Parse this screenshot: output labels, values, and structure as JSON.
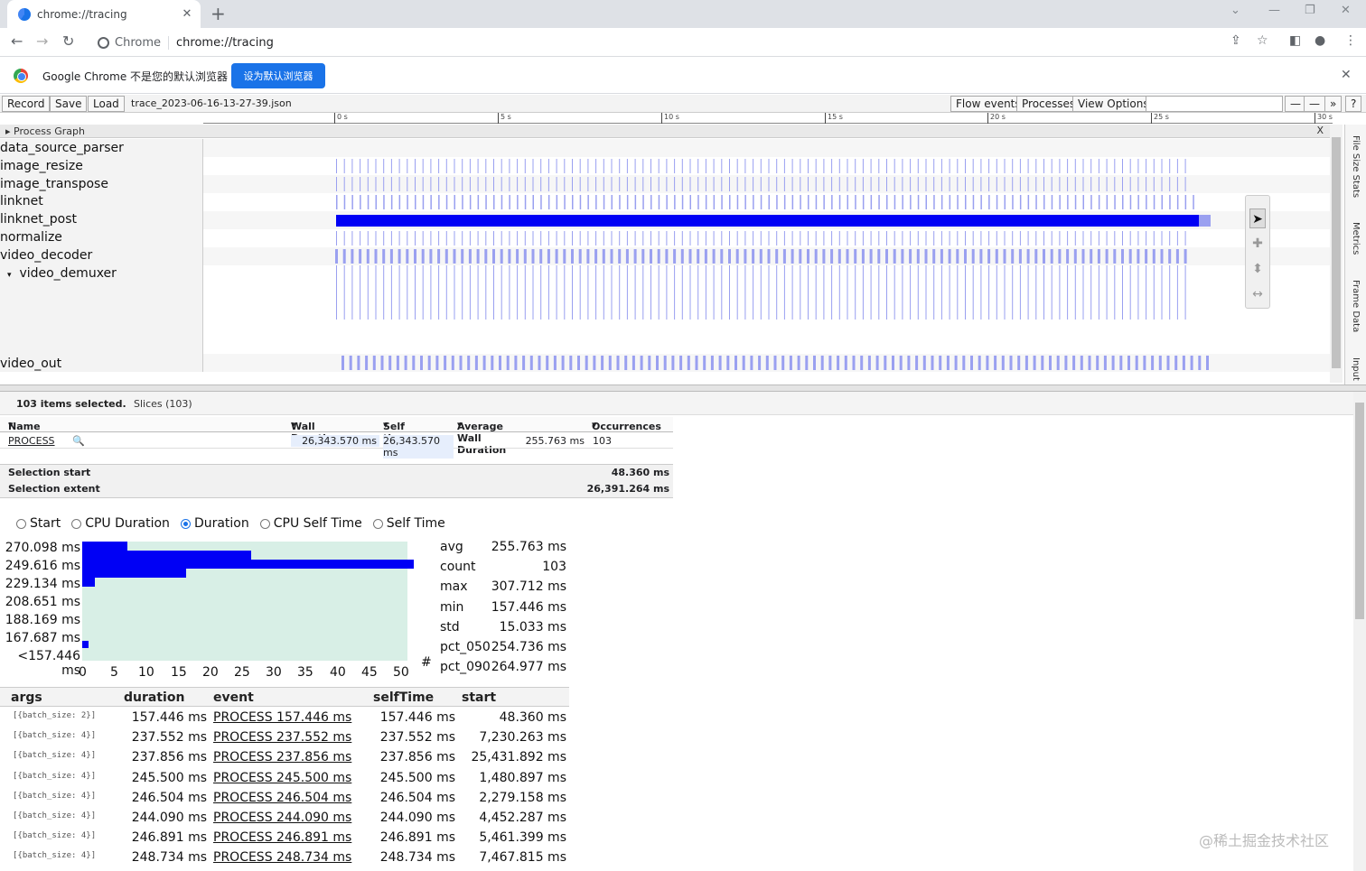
{
  "browser": {
    "tab_title": "chrome://tracing",
    "site_chip": "Chrome",
    "url": "chrome://tracing",
    "infobar_message": "Google Chrome 不是您的默认浏览器",
    "infobar_button": "设为默认浏览器"
  },
  "tracing_toolbar": {
    "record": "Record",
    "save": "Save",
    "load": "Load",
    "filename": "trace_2023-06-16-13-27-39.json",
    "flow_events": "Flow events",
    "processes": "Processes",
    "view_options": "View Options",
    "more": "»",
    "help": "?"
  },
  "ruler": {
    "ticks": [
      "0 s",
      "5 s",
      "10 s",
      "15 s",
      "20 s",
      "25 s",
      "30 s"
    ]
  },
  "process_graph": {
    "title": "Process Graph",
    "close": "X",
    "tracks": [
      "data_source_parser",
      "image_resize",
      "image_transpose",
      "linknet",
      "linknet_post",
      "normalize",
      "video_decoder",
      "video_demuxer",
      "video_out"
    ]
  },
  "side_tabs": [
    "File Size Stats",
    "Metrics",
    "Frame Data",
    "Input"
  ],
  "analysis": {
    "selected": "103 items selected.",
    "slices_tab": "Slices (103)",
    "columns": [
      "Name",
      "Wall Duration",
      "Self time",
      "Average Wall Duration",
      "Occurrences"
    ],
    "row": {
      "name": "PROCESS",
      "wall_duration": "26,343.570 ms",
      "self_time": "26,343.570 ms",
      "avg_wall": "255.763 ms",
      "occurrences": "103"
    },
    "selection_start_label": "Selection start",
    "selection_start": "48.360 ms",
    "selection_extent_label": "Selection extent",
    "selection_extent": "26,391.264 ms"
  },
  "radios": [
    {
      "label": "Start",
      "checked": false
    },
    {
      "label": "CPU Duration",
      "checked": false
    },
    {
      "label": "Duration",
      "checked": true
    },
    {
      "label": "CPU Self Time",
      "checked": false
    },
    {
      "label": "Self Time",
      "checked": false
    }
  ],
  "histogram": {
    "y_labels": [
      "270.098 ms",
      "249.616 ms",
      "229.134 ms",
      "208.651 ms",
      "188.169 ms",
      "167.687 ms",
      "<157.446 ms"
    ],
    "x_labels": [
      "0",
      "5",
      "10",
      "15",
      "20",
      "25",
      "30",
      "35",
      "40",
      "45",
      "50"
    ],
    "x_unit": "#",
    "counts": [
      {
        "bin": "270.098 ms",
        "count": 7
      },
      {
        "bin": "259.857 ms",
        "count": 26
      },
      {
        "bin": "249.616 ms",
        "count": 51
      },
      {
        "bin": "239.375 ms",
        "count": 16
      },
      {
        "bin": "229.134 ms",
        "count": 2
      },
      {
        "bin": "157.446 ms",
        "count": 1
      }
    ]
  },
  "stats": [
    {
      "k": "avg",
      "v": "255.763 ms"
    },
    {
      "k": "count",
      "v": "103"
    },
    {
      "k": "max",
      "v": "307.712 ms"
    },
    {
      "k": "min",
      "v": "157.446 ms"
    },
    {
      "k": "std",
      "v": "15.033 ms"
    },
    {
      "k": "pct_050",
      "v": "254.736 ms"
    },
    {
      "k": "pct_090",
      "v": "264.977 ms"
    }
  ],
  "arg_table": {
    "columns": [
      "args",
      "duration",
      "event",
      "selfTime",
      "start"
    ],
    "rows": [
      {
        "args": "[{batch_size: 2}]",
        "duration": "157.446 ms",
        "event": "PROCESS 157.446 ms",
        "self": "157.446 ms",
        "start": "48.360 ms"
      },
      {
        "args": "[{batch_size: 4}]",
        "duration": "237.552 ms",
        "event": "PROCESS 237.552 ms",
        "self": "237.552 ms",
        "start": "7,230.263 ms"
      },
      {
        "args": "[{batch_size: 4}]",
        "duration": "237.856 ms",
        "event": "PROCESS 237.856 ms",
        "self": "237.856 ms",
        "start": "25,431.892 ms"
      },
      {
        "args": "[{batch_size: 4}]",
        "duration": "245.500 ms",
        "event": "PROCESS 245.500 ms",
        "self": "245.500 ms",
        "start": "1,480.897 ms"
      },
      {
        "args": "[{batch_size: 4}]",
        "duration": "246.504 ms",
        "event": "PROCESS 246.504 ms",
        "self": "246.504 ms",
        "start": "2,279.158 ms"
      },
      {
        "args": "[{batch_size: 4}]",
        "duration": "244.090 ms",
        "event": "PROCESS 244.090 ms",
        "self": "244.090 ms",
        "start": "4,452.287 ms"
      },
      {
        "args": "[{batch_size: 4}]",
        "duration": "246.891 ms",
        "event": "PROCESS 246.891 ms",
        "self": "246.891 ms",
        "start": "5,461.399 ms"
      },
      {
        "args": "[{batch_size: 4}]",
        "duration": "248.734 ms",
        "event": "PROCESS 248.734 ms",
        "self": "248.734 ms",
        "start": "7,467.815 ms"
      }
    ]
  },
  "watermark": "@稀土掘金技术社区",
  "colors": {
    "slice": "#0000f5",
    "slice_light": "#9aa0f0",
    "hist_bg": "#d8efe6",
    "accent": "#1a73e8"
  }
}
